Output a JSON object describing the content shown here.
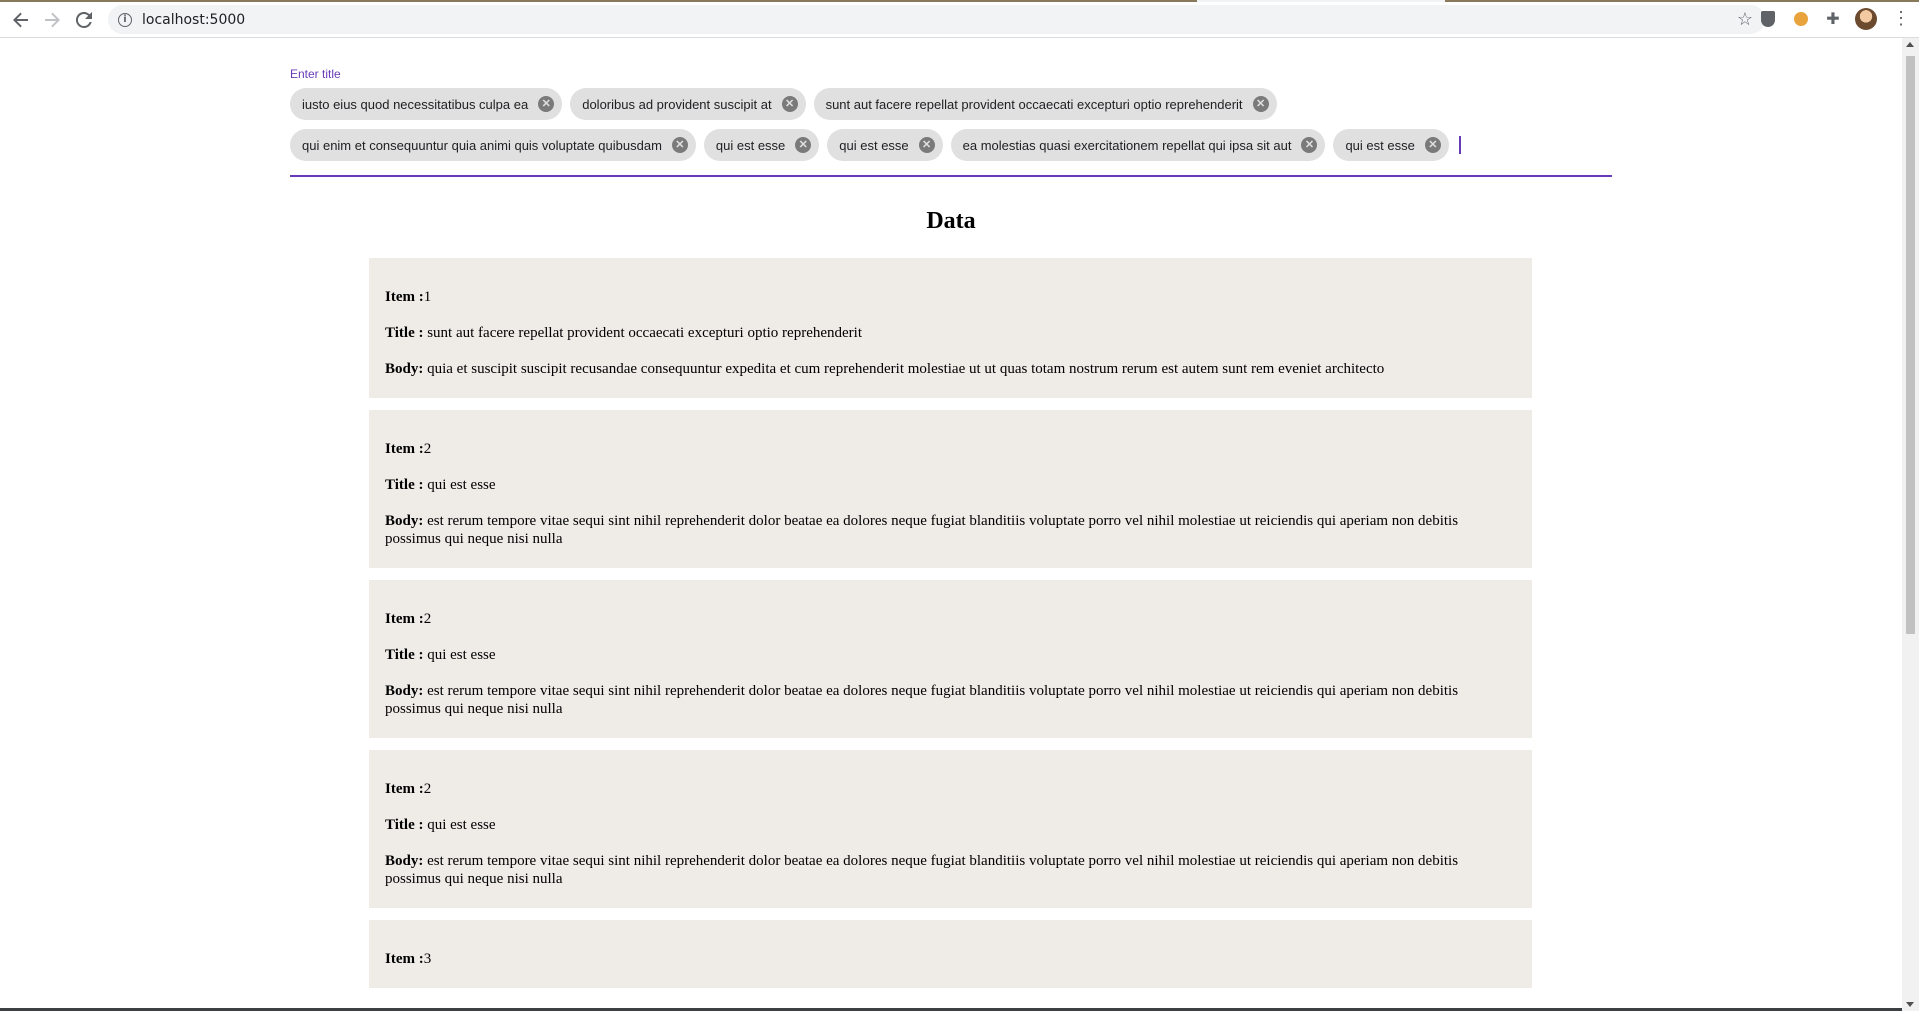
{
  "browser": {
    "url": "localhost:5000"
  },
  "autocomplete": {
    "label": "Enter title",
    "chips": [
      "iusto eius quod necessitatibus culpa ea",
      "doloribus ad provident suscipit at",
      "sunt aut facere repellat provident occaecati excepturi optio reprehenderit",
      "qui enim et consequuntur quia animi quis voluptate quibusdam",
      "qui est esse",
      "qui est esse",
      "ea molestias quasi exercitationem repellat qui ipsa sit aut",
      "qui est esse"
    ]
  },
  "page": {
    "heading": "Data",
    "item_label": "Item :",
    "title_label": "Title :",
    "body_label": "Body:"
  },
  "items": [
    {
      "id": "1",
      "title": "sunt aut facere repellat provident occaecati excepturi optio reprehenderit",
      "body": "quia et suscipit suscipit recusandae consequuntur expedita et cum reprehenderit molestiae ut ut quas totam nostrum rerum est autem sunt rem eveniet architecto"
    },
    {
      "id": "2",
      "title": "qui est esse",
      "body": "est rerum tempore vitae sequi sint nihil reprehenderit dolor beatae ea dolores neque fugiat blanditiis voluptate porro vel nihil molestiae ut reiciendis qui aperiam non debitis possimus qui neque nisi nulla"
    },
    {
      "id": "2",
      "title": "qui est esse",
      "body": "est rerum tempore vitae sequi sint nihil reprehenderit dolor beatae ea dolores neque fugiat blanditiis voluptate porro vel nihil molestiae ut reiciendis qui aperiam non debitis possimus qui neque nisi nulla"
    },
    {
      "id": "2",
      "title": "qui est esse",
      "body": "est rerum tempore vitae sequi sint nihil reprehenderit dolor beatae ea dolores neque fugiat blanditiis voluptate porro vel nihil molestiae ut reiciendis qui aperiam non debitis possimus qui neque nisi nulla"
    },
    {
      "id": "3"
    }
  ],
  "colors": {
    "accent": "#673ab7",
    "chip_bg": "#e0e0e0",
    "card_bg": "#efece8"
  }
}
